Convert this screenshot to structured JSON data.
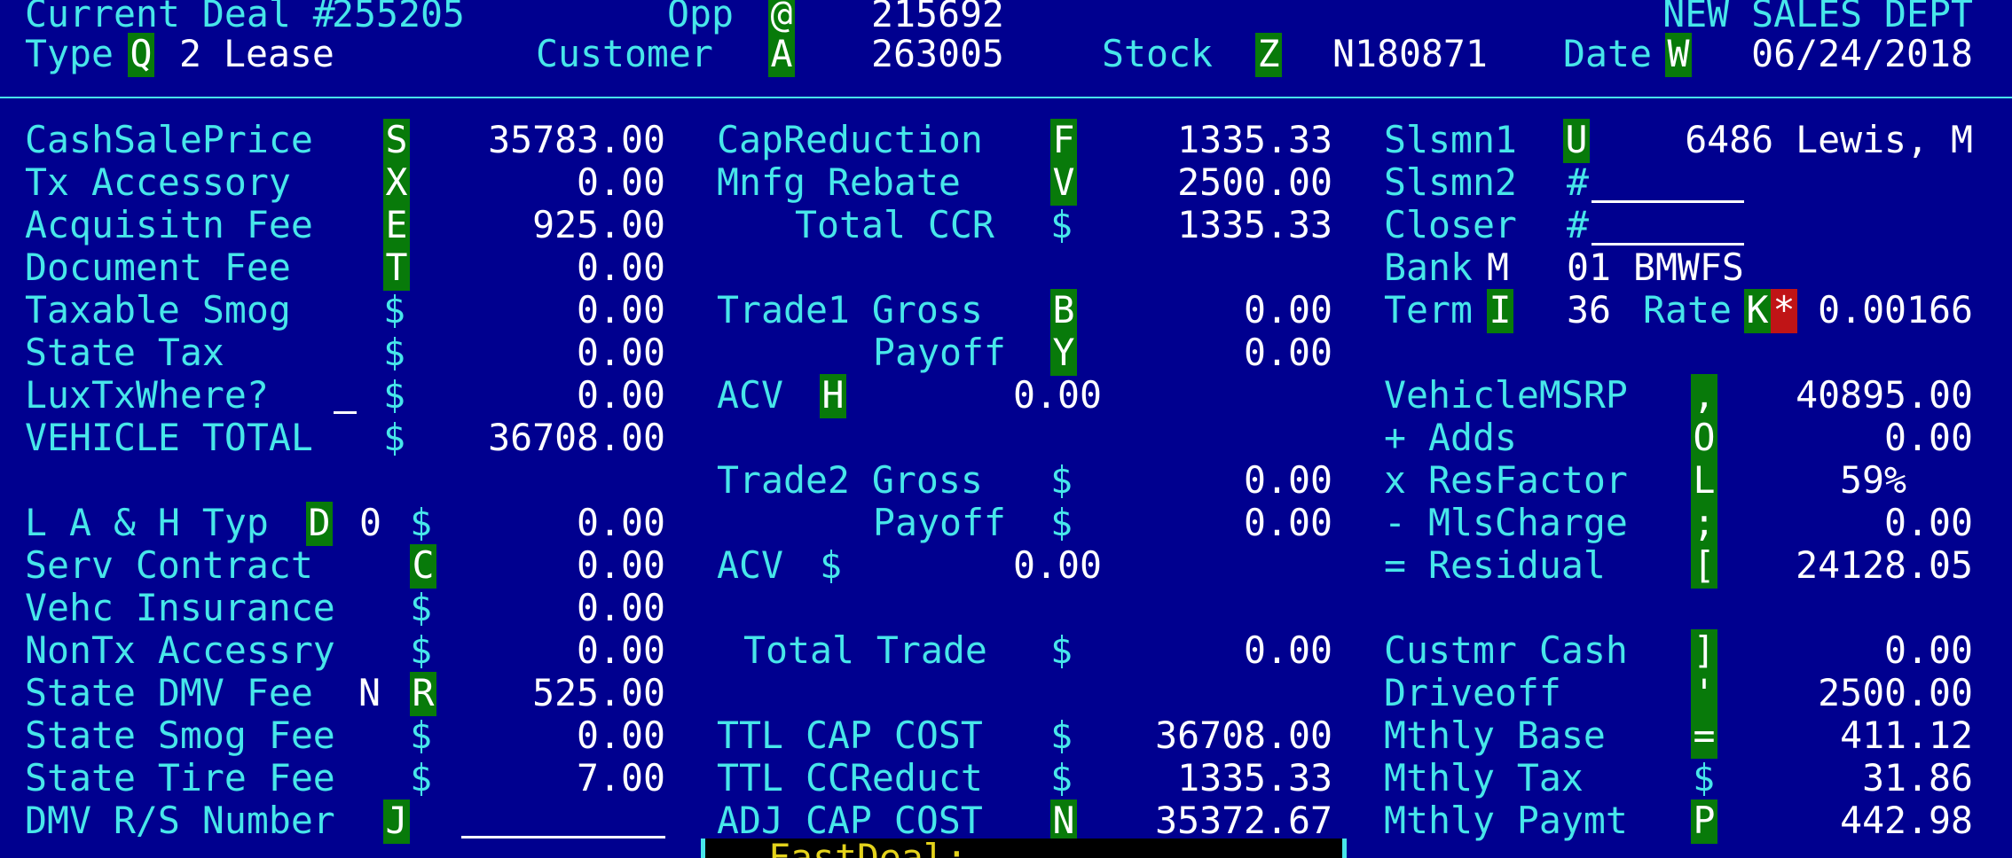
{
  "header": {
    "current_deal_label": "Current Deal #",
    "deal_number": "255205",
    "opp_label": "Opp",
    "opp_key": "@",
    "opp_value": "215692",
    "dept": "NEW SALES DEPT",
    "type_label": "Type",
    "type_key": "Q",
    "type_value": "2 Lease",
    "customer_label": "Customer",
    "customer_key": "A",
    "customer_value": "263005",
    "stock_label": "Stock",
    "stock_key": "Z",
    "stock_value": "N180871",
    "date_label": "Date",
    "date_key": "W",
    "date_value": "06/24/2018"
  },
  "col1": [
    {
      "label": "CashSalePrice",
      "key": "S",
      "value": "35783.00"
    },
    {
      "label": "Tx Accessory",
      "key": "X",
      "value": "0.00"
    },
    {
      "label": "Acquisitn Fee",
      "key": "E",
      "value": "925.00"
    },
    {
      "label": "Document Fee",
      "key": "T",
      "value": "0.00"
    },
    {
      "label": "Taxable Smog",
      "key": "$",
      "value": "0.00"
    },
    {
      "label": "State Tax",
      "key": "$",
      "value": "0.00"
    },
    {
      "label": "LuxTxWhere?",
      "key": "$",
      "value": "0.00"
    },
    {
      "label": "VEHICLE TOTAL",
      "key": "$",
      "value": "36708.00"
    },
    {
      "label": "L A & H Typ",
      "key": "D",
      "extra": "0",
      "dollar": "$",
      "value": "0.00"
    },
    {
      "label": "Serv Contract",
      "key": "C",
      "value": "0.00"
    },
    {
      "label": "Vehc Insurance",
      "key": "$",
      "value": "0.00"
    },
    {
      "label": "NonTx Accessry",
      "key": "$",
      "value": "0.00"
    },
    {
      "label": "State DMV Fee",
      "flag": "N",
      "key": "R",
      "value": "525.00"
    },
    {
      "label": "State Smog Fee",
      "key": "$",
      "value": "0.00"
    },
    {
      "label": "State Tire Fee",
      "key": "$",
      "value": "7.00"
    },
    {
      "label": "DMV R/S Number",
      "key": "J",
      "value": ""
    }
  ],
  "col2": {
    "cap_reduction": {
      "label": "CapReduction",
      "key": "F",
      "value": "1335.33"
    },
    "mnfg_rebate": {
      "label": "Mnfg Rebate",
      "key": "V",
      "value": "2500.00"
    },
    "total_ccr": {
      "label": "Total CCR",
      "key": "$",
      "value": "1335.33"
    },
    "trade1_gross": {
      "label": "Trade1 Gross",
      "key": "B",
      "value": "0.00"
    },
    "trade1_payoff": {
      "label": "Payoff",
      "key": "Y",
      "value": "0.00"
    },
    "trade1_acv": {
      "label": "ACV",
      "key": "H",
      "value": "0.00"
    },
    "trade2_gross": {
      "label": "Trade2 Gross",
      "key": "$",
      "value": "0.00"
    },
    "trade2_payoff": {
      "label": "Payoff",
      "key": "$",
      "value": "0.00"
    },
    "trade2_acv": {
      "label": "ACV",
      "key": "$",
      "value": "0.00"
    },
    "total_trade": {
      "label": "Total Trade",
      "key": "$",
      "value": "0.00"
    },
    "ttl_cap_cost": {
      "label": "TTL CAP COST",
      "key": "$",
      "value": "36708.00"
    },
    "ttl_ccreduct": {
      "label": "TTL CCReduct",
      "key": "$",
      "value": "1335.33"
    },
    "adj_cap_cost": {
      "label": "ADJ CAP COST",
      "key": "N",
      "value": "35372.67"
    }
  },
  "col3": {
    "slsmn1": {
      "label": "Slsmn1",
      "key": "U",
      "value": "6486 Lewis, M"
    },
    "slsmn2": {
      "label": "Slsmn2",
      "hash": "#",
      "value": ""
    },
    "closer": {
      "label": "Closer",
      "hash": "#",
      "value": ""
    },
    "bank": {
      "label": "Bank",
      "key": "M",
      "value": "01 BMWFS"
    },
    "term": {
      "label": "Term",
      "key": "I",
      "value": "36"
    },
    "rate": {
      "label": "Rate",
      "key": "K",
      "flag": "*",
      "value": "0.00166"
    },
    "rows": [
      {
        "label": "VehicleMSRP",
        "key": ",",
        "value": "40895.00"
      },
      {
        "label": "+ Adds",
        "key": "O",
        "value": "0.00"
      },
      {
        "label": "x ResFactor",
        "key": "L",
        "value": "59",
        "suffix": "%"
      },
      {
        "label": "- MlsCharge",
        "key": ";",
        "value": "0.00"
      },
      {
        "label": "= Residual",
        "key": "[",
        "value": "24128.05"
      }
    ],
    "rows2": [
      {
        "label": "Custmr Cash",
        "key": "]",
        "value": "0.00"
      },
      {
        "label": "Driveoff",
        "key": "'",
        "value": "2500.00"
      },
      {
        "label": "Mthly Base",
        "key": "=",
        "value": "411.12"
      },
      {
        "label": "Mthly Tax",
        "key": "$",
        "value": "31.86"
      },
      {
        "label": "Mthly Paymt",
        "key": "P",
        "value": "442.98"
      }
    ]
  },
  "footer": {
    "fastdeal_label": "FastDeal:"
  },
  "colors": {
    "background": "#00008f",
    "label": "#47e6ea",
    "value": "#ffffff",
    "key_bg": "#087a0a",
    "flag_bg": "#c01416",
    "fastdeal": "#e3d21b"
  }
}
